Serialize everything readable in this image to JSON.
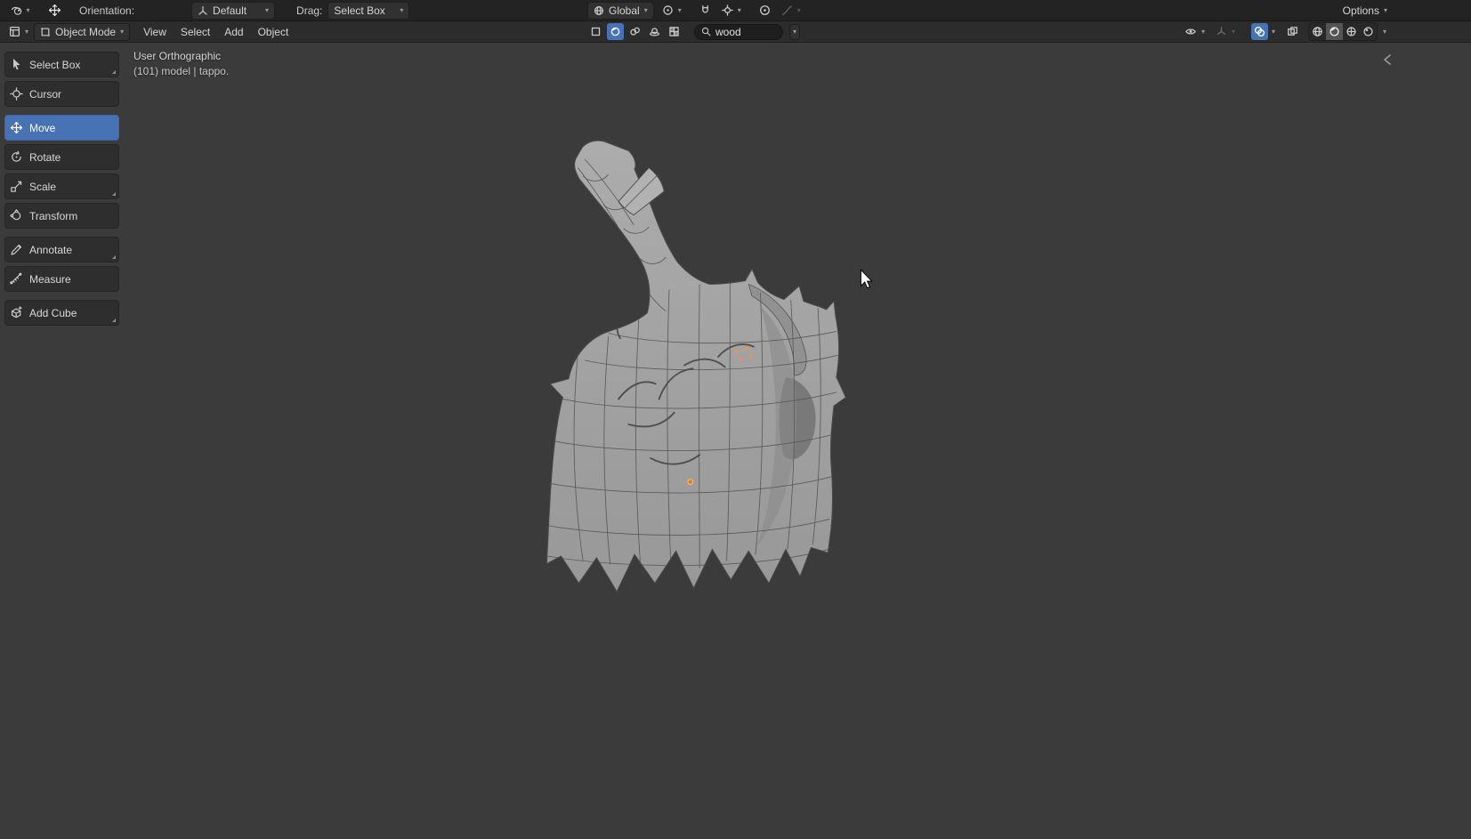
{
  "topbar": {
    "orientation_label": "Orientation:",
    "orientation_value": "Default",
    "drag_label": "Drag:",
    "drag_value": "Select Box",
    "transform_orientation_value": "Global",
    "options_label": "Options"
  },
  "viewport_header": {
    "mode_value": "Object Mode",
    "menus": [
      "View",
      "Select",
      "Add",
      "Object"
    ],
    "search_value": "wood"
  },
  "tool_shelf": {
    "tools": [
      {
        "label": "Select Box",
        "active": false,
        "has_flyout": true
      },
      {
        "label": "Cursor",
        "active": false,
        "has_flyout": false
      },
      {
        "label": "Move",
        "active": true,
        "has_flyout": false
      },
      {
        "label": "Rotate",
        "active": false,
        "has_flyout": false
      },
      {
        "label": "Scale",
        "active": false,
        "has_flyout": true
      },
      {
        "label": "Transform",
        "active": false,
        "has_flyout": false
      },
      {
        "label": "Annotate",
        "active": false,
        "has_flyout": true
      },
      {
        "label": "Measure",
        "active": false,
        "has_flyout": false
      },
      {
        "label": "Add Cube",
        "active": false,
        "has_flyout": true
      }
    ]
  },
  "viewport": {
    "view_text": "User Orthographic",
    "scene_text": "(101) model | tappo."
  },
  "icons": {
    "blender-logo-icon": "app menu swirl",
    "move-tool-icon": "four-way arrows",
    "axis-orientation-icon": "mini axes",
    "global-orientation-icon": "globe",
    "pivot-point-icon": "circle with center dot",
    "snap-magnet-icon": "magnet",
    "snap-target-icon": "target crosshair",
    "proportional-edit-icon": "concentric circles",
    "falloff-curve-icon": "curve",
    "editor-type-icon": "viewport grid square",
    "object-mode-icon": "square object",
    "search-icon": "magnifier",
    "visibility-eye-icon": "eye",
    "gizmo-icon": "axis tripod",
    "overlays-icon": "two overlapping circles",
    "xray-toggle-icon": "overlapping squares",
    "shading-wireframe-icon": "wire sphere",
    "shading-solid-icon": "solid sphere",
    "shading-material-icon": "checker sphere",
    "shading-rendered-icon": "shaded sphere"
  },
  "colors": {
    "accent_blue": "#4772b3",
    "viewport_bg": "#3b3b3b",
    "topbar_bg": "#232323",
    "header_bg": "#2c2c2c",
    "tool_button_bg": "#2e2e2e",
    "origin_orange": "#e87d0d",
    "selection_orange": "#ff8c3c"
  }
}
